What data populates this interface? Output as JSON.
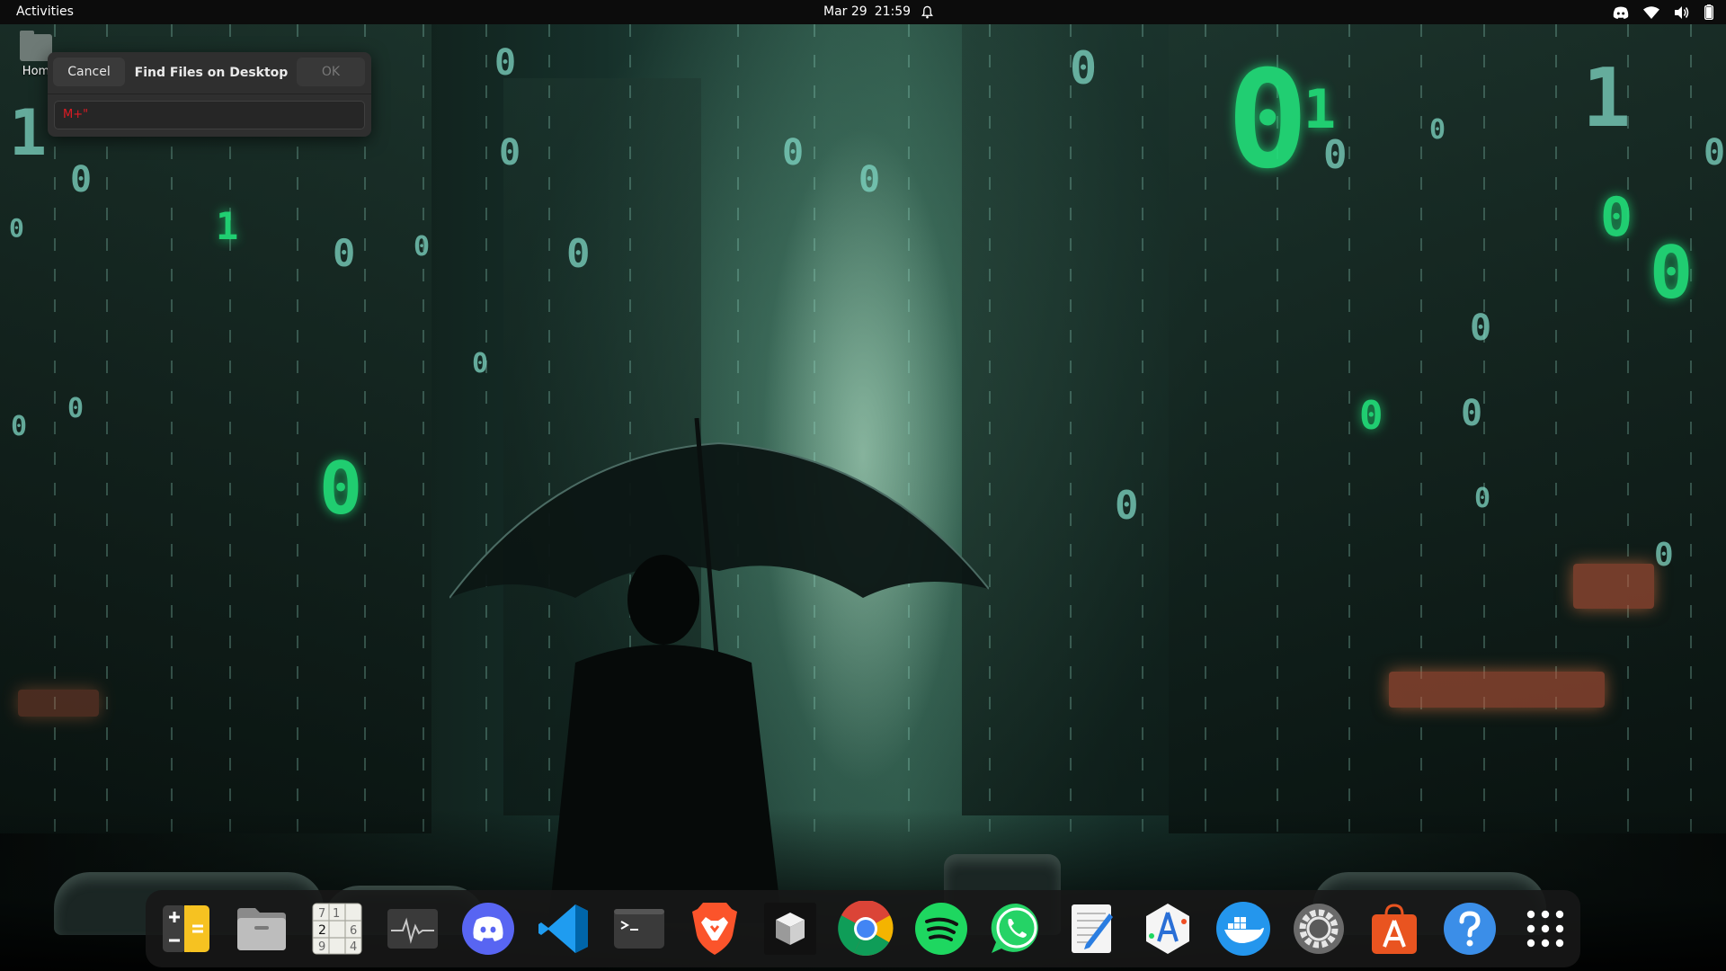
{
  "topbar": {
    "activities": "Activities",
    "date": "Mar 29",
    "time": "21:59",
    "tray_icons": [
      "discord-tray-icon",
      "wifi-icon",
      "volume-icon",
      "battery-icon"
    ]
  },
  "desktop": {
    "home_label": "Hom"
  },
  "dialog": {
    "cancel_label": "Cancel",
    "title": "Find Files on Desktop",
    "ok_label": "OK",
    "input_value": "M+\""
  },
  "dock": {
    "items": [
      {
        "name": "calculator",
        "icon": "calculator-icon"
      },
      {
        "name": "files",
        "icon": "folder-icon"
      },
      {
        "name": "sudoku",
        "icon": "sudoku-icon"
      },
      {
        "name": "system-monitor",
        "icon": "system-monitor-icon"
      },
      {
        "name": "discord",
        "icon": "discord-icon"
      },
      {
        "name": "vscode",
        "icon": "vscode-icon"
      },
      {
        "name": "terminal",
        "icon": "terminal-icon"
      },
      {
        "name": "brave",
        "icon": "brave-icon"
      },
      {
        "name": "3d-app",
        "icon": "cube-icon"
      },
      {
        "name": "chrome",
        "icon": "chrome-icon"
      },
      {
        "name": "spotify",
        "icon": "spotify-icon"
      },
      {
        "name": "whatsapp",
        "icon": "whatsapp-icon"
      },
      {
        "name": "text-editor",
        "icon": "text-editor-icon"
      },
      {
        "name": "app-store",
        "icon": "app-store-icon"
      },
      {
        "name": "docker",
        "icon": "docker-icon"
      },
      {
        "name": "settings",
        "icon": "settings-gear-icon"
      },
      {
        "name": "software",
        "icon": "software-bag-icon"
      },
      {
        "name": "help",
        "icon": "help-icon"
      },
      {
        "name": "show-apps",
        "icon": "app-grid-icon"
      }
    ],
    "sudoku_digits": [
      "7",
      "1",
      "2",
      "6",
      "9",
      "4"
    ]
  },
  "colors": {
    "accent_green": "#22e07a",
    "input_text": "#e01b24",
    "dock_bg": "#181818"
  }
}
